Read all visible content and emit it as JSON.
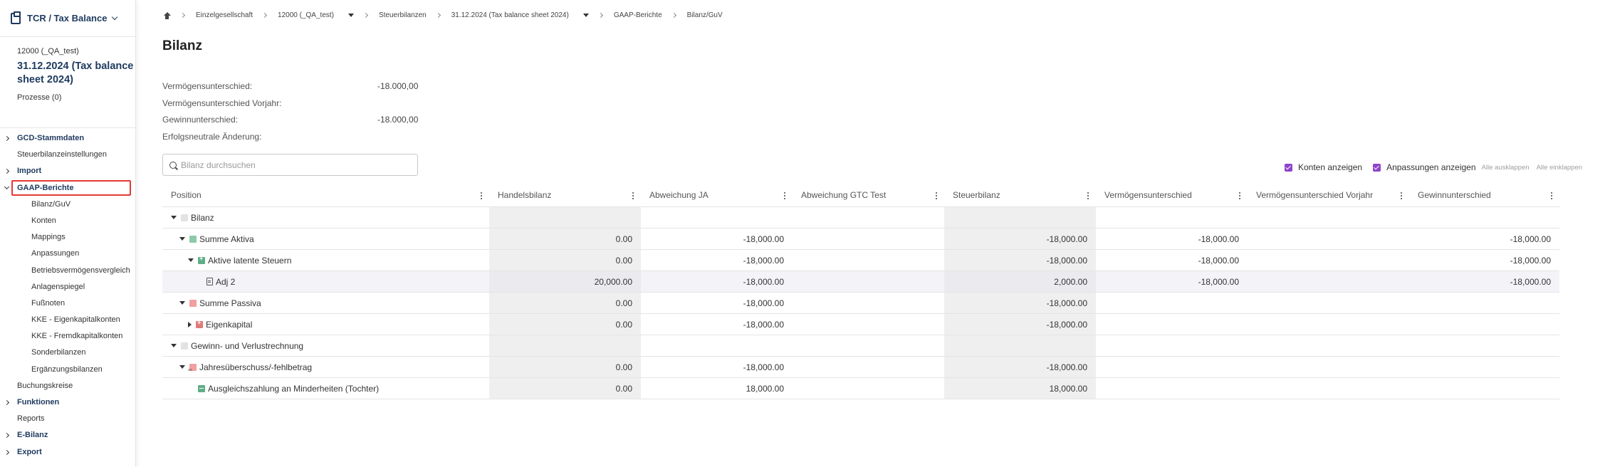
{
  "app": {
    "title": "TCR / Tax Balance"
  },
  "entity": {
    "code": "12000 (_QA_test)",
    "period": "31.12.2024 (Tax balance sheet 2024)",
    "processes": "Prozesse (0)"
  },
  "sidebar": {
    "items": [
      {
        "label": "GCD-Stammdaten",
        "bold": true,
        "caret": "closed"
      },
      {
        "label": "Steuerbilanzeinstellungen",
        "bold": false
      },
      {
        "label": "Import",
        "bold": true,
        "caret": "closed"
      },
      {
        "label": "GAAP-Berichte",
        "bold": true,
        "caret": "open",
        "highlight": true
      },
      {
        "label": "Bilanz/GuV",
        "sub": true
      },
      {
        "label": "Konten",
        "sub": true
      },
      {
        "label": "Mappings",
        "sub": true
      },
      {
        "label": "Anpassungen",
        "sub": true
      },
      {
        "label": "Betriebsvermögensvergleich",
        "sub": true
      },
      {
        "label": "Anlagenspiegel",
        "sub": true
      },
      {
        "label": "Fußnoten",
        "sub": true
      },
      {
        "label": "KKE - Eigenkapitalkonten",
        "sub": true
      },
      {
        "label": "KKE - Fremdkapitalkonten",
        "sub": true
      },
      {
        "label": "Sonderbilanzen",
        "sub": true
      },
      {
        "label": "Ergänzungsbilanzen",
        "sub": true
      },
      {
        "label": "Buchungskreise",
        "bold": false
      },
      {
        "label": "Funktionen",
        "bold": true,
        "caret": "closed"
      },
      {
        "label": "Reports",
        "bold": false
      },
      {
        "label": "E-Bilanz",
        "bold": true,
        "caret": "closed"
      },
      {
        "label": "Export",
        "bold": true,
        "caret": "closed"
      }
    ]
  },
  "breadcrumb": {
    "items": [
      "Einzelgesellschaft",
      "12000 (_QA_test)",
      "Steuerbilanzen",
      "31.12.2024 (Tax balance sheet 2024)",
      "GAAP-Berichte",
      "Bilanz/GuV"
    ]
  },
  "page": {
    "title": "Bilanz"
  },
  "summary": {
    "rows": [
      {
        "label": "Vermögensunterschied:",
        "value": "-18.000,00"
      },
      {
        "label": "Vermögensunterschied Vorjahr:",
        "value": ""
      },
      {
        "label": "Gewinnunterschied:",
        "value": "-18.000,00"
      },
      {
        "label": "Erfolgsneutrale Änderung:",
        "value": ""
      }
    ]
  },
  "search": {
    "placeholder": "Bilanz durchsuchen",
    "value": ""
  },
  "toolbar": {
    "show_accounts": "Konten anzeigen",
    "show_adjustments": "Anpassungen anzeigen",
    "expand_all": "Alle ausklappen",
    "collapse_all": "Alle einklappen",
    "checkbox_color": "#8e44c9"
  },
  "table": {
    "columns": [
      "Position",
      "Handelsbilanz",
      "Abweichung JA",
      "Abweichung GTC Test",
      "Steuerbilanz",
      "Vermögensunterschied",
      "Vermögensunterschied Vorjahr",
      "Gewinnunterschied"
    ],
    "rows": [
      {
        "label": "Bilanz",
        "indent": 0,
        "toggle": "down",
        "icon": "grey",
        "values": [
          "",
          "",
          "",
          "",
          "",
          "",
          ""
        ]
      },
      {
        "label": "Summe Aktiva",
        "indent": 1,
        "toggle": "down",
        "icon": "green",
        "values": [
          "0.00",
          "-18,000.00",
          "",
          "-18,000.00",
          "-18,000.00",
          "",
          "-18,000.00"
        ]
      },
      {
        "label": "Aktive latente Steuern",
        "indent": 2,
        "toggle": "down",
        "icon": "green-plus",
        "values": [
          "0.00",
          "-18,000.00",
          "",
          "-18,000.00",
          "-18,000.00",
          "",
          "-18,000.00"
        ]
      },
      {
        "label": "Adj 2",
        "indent": 3,
        "toggle": "none",
        "icon": "doc",
        "selected": true,
        "values": [
          "20,000.00",
          "-18,000.00",
          "",
          "2,000.00",
          "-18,000.00",
          "",
          "-18,000.00"
        ]
      },
      {
        "label": "Summe Passiva",
        "indent": 1,
        "toggle": "down",
        "icon": "red",
        "values": [
          "0.00",
          "-18,000.00",
          "",
          "-18,000.00",
          "",
          "",
          ""
        ]
      },
      {
        "label": "Eigenkapital",
        "indent": 2,
        "toggle": "right",
        "icon": "red-plus",
        "values": [
          "0.00",
          "-18,000.00",
          "",
          "-18,000.00",
          "",
          "",
          ""
        ]
      },
      {
        "label": "Gewinn- und Verlustrechnung",
        "indent": 0,
        "toggle": "down",
        "icon": "grey",
        "values": [
          "",
          "",
          "",
          "",
          "",
          "",
          ""
        ]
      },
      {
        "label": "Jahresüberschuss/-fehlbetrag",
        "indent": 1,
        "toggle": "down",
        "icon": "red-link",
        "values": [
          "0.00",
          "-18,000.00",
          "",
          "-18,000.00",
          "",
          "",
          ""
        ]
      },
      {
        "label": "Ausgleichszahlung an Minderheiten (Tochter)",
        "indent": 2,
        "toggle": "none",
        "icon": "green-minus",
        "values": [
          "0.00",
          "18,000.00",
          "",
          "18,000.00",
          "",
          "",
          ""
        ]
      }
    ]
  }
}
